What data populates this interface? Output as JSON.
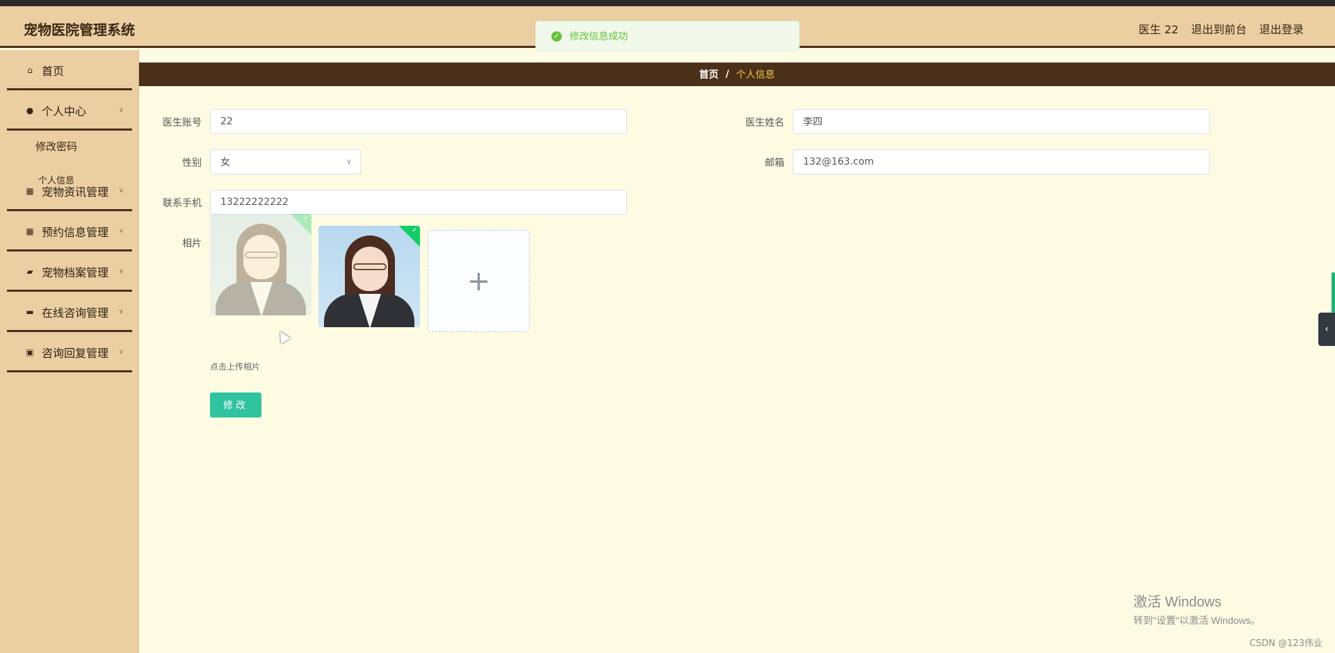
{
  "app": {
    "title": "宠物医院管理系统"
  },
  "header": {
    "user_label": "医生 22",
    "back_front": "退出到前台",
    "logout": "退出登录"
  },
  "toast": {
    "message": "修改信息成功"
  },
  "sidebar": {
    "items": [
      {
        "label": "首页",
        "icon": "home-icon"
      },
      {
        "label": "个人中心",
        "icon": "user-icon"
      },
      {
        "label": "宠物资讯管理",
        "icon": "grid-icon"
      },
      {
        "label": "预约信息管理",
        "icon": "grid-icon"
      },
      {
        "label": "宠物档案管理",
        "icon": "folder-icon"
      },
      {
        "label": "在线咨询管理",
        "icon": "briefcase-icon"
      },
      {
        "label": "咨询回复管理",
        "icon": "clipboard-icon"
      }
    ],
    "sub_items": [
      {
        "label": "修改密码"
      },
      {
        "label": "个人信息"
      }
    ]
  },
  "breadcrumb": {
    "home": "首页",
    "separator": "/",
    "current": "个人信息"
  },
  "form": {
    "account_label": "医生账号",
    "account_value": "22",
    "name_label": "医生姓名",
    "name_value": "李四",
    "gender_label": "性别",
    "gender_value": "女",
    "email_label": "邮箱",
    "email_value": "132@163.com",
    "phone_label": "联系手机",
    "phone_value": "13222222222",
    "photo_label": "相片",
    "upload_tip": "点击上传相片",
    "submit_label": "修改"
  },
  "watermark": {
    "line1": "激活 Windows",
    "line2": "转到\"设置\"以激活 Windows。",
    "credit": "CSDN @123伟业"
  },
  "colors": {
    "header_bg": "#ebcfa2",
    "dark_brown": "#4a3019",
    "page_bg": "#fefbe3",
    "accent_gold": "#f2c94c",
    "submit_button": "#30c3a0",
    "success_green": "#67c23a"
  }
}
